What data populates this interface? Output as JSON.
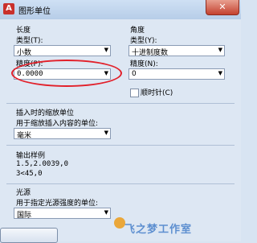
{
  "window": {
    "title": "图形单位",
    "close_glyph": "✕"
  },
  "length": {
    "section_label": "长度",
    "type_label": "类型(T):",
    "type_value": "小数",
    "precision_label": "精度(P):",
    "precision_value": "0.0000"
  },
  "angle": {
    "section_label": "角度",
    "type_label": "类型(Y):",
    "type_value": "十进制度数",
    "precision_label": "精度(N):",
    "precision_value": "0",
    "clockwise_label": "顺时针(C)",
    "clockwise_checked": false
  },
  "insertion": {
    "section_label": "插入时的缩放单位",
    "desc": "用于缩放插入内容的单位:",
    "value": "毫米"
  },
  "sample": {
    "section_label": "输出样例",
    "line1": "1.5,2.0039,0",
    "line2": "3<45,0"
  },
  "lighting": {
    "section_label": "光源",
    "desc": "用于指定光源强度的单位:",
    "value": "国际"
  },
  "watermark": {
    "text": "飞之梦工作室"
  },
  "colors": {
    "annotation_circle": "#e2202a",
    "title_bar": "#cfe0f4",
    "panel": "#dde7f3"
  }
}
